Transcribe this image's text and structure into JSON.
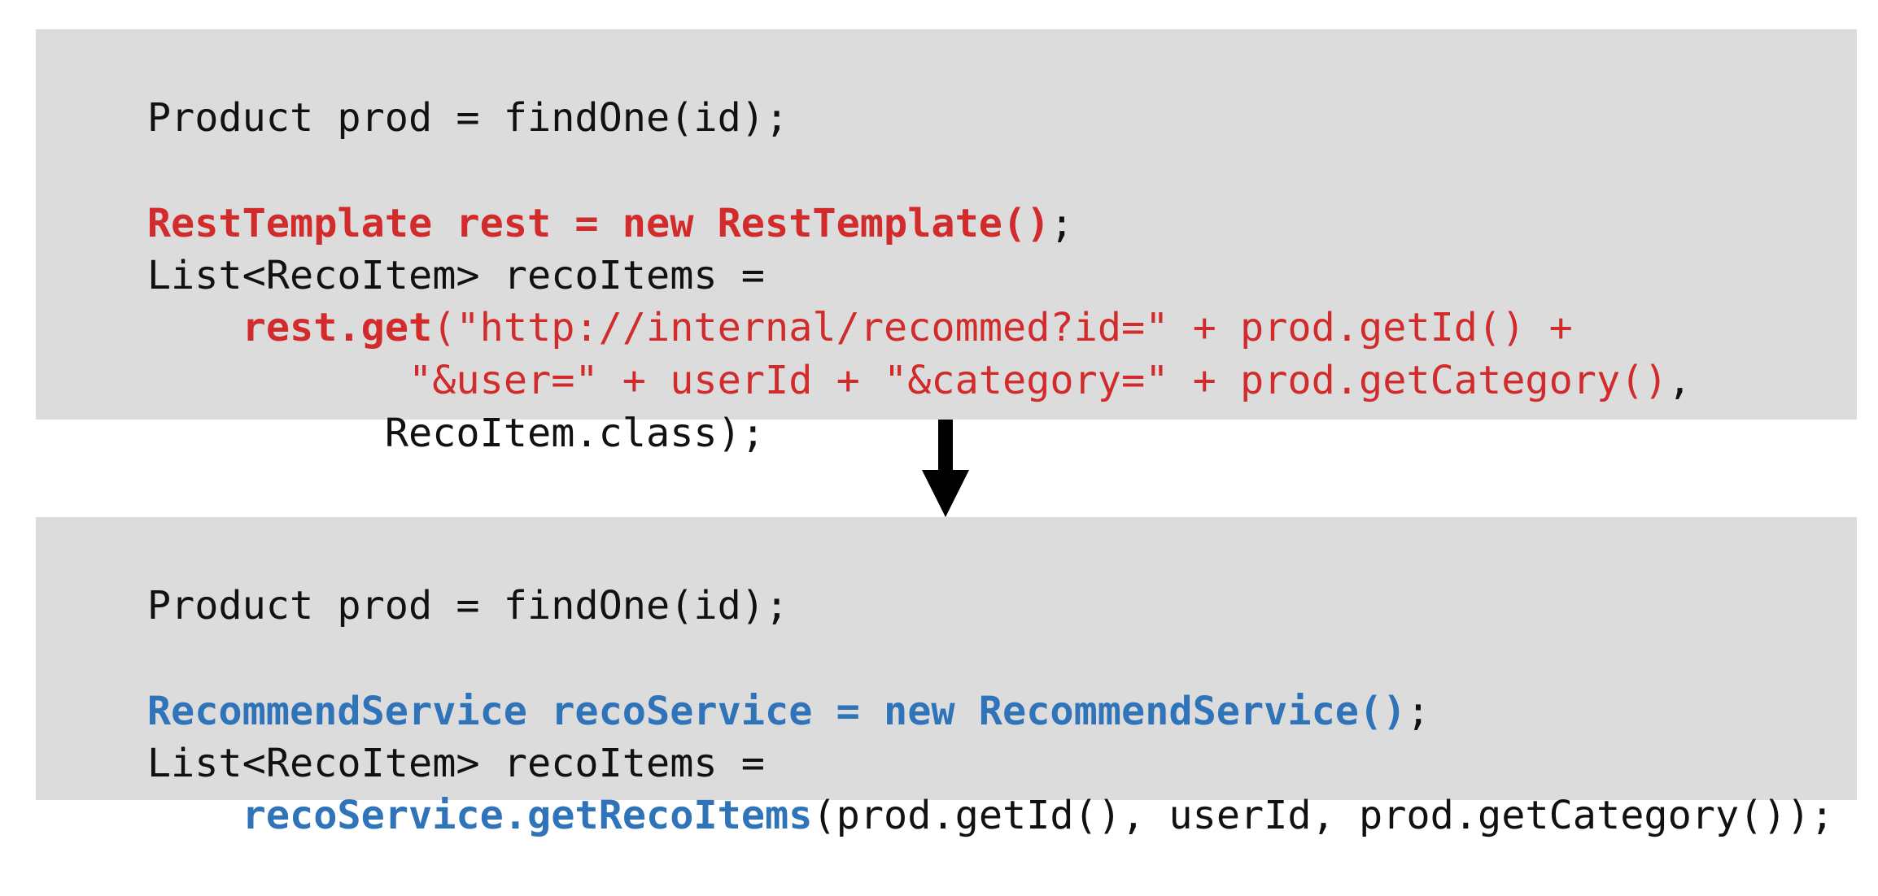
{
  "top_panel": {
    "line1": "Product prod = findOne(id);",
    "line2": {
      "new_rest": "RestTemplate rest = new RestTemplate()",
      "semicolon": ";"
    },
    "line3": "List<RecoItem> recoItems =",
    "line4": {
      "indent": "    ",
      "call": "rest.get",
      "url_part": "(\"http://internal/recommed?id=\" + prod.getId() +"
    },
    "line5": {
      "indent": "           ",
      "params": "\"&user=\" + userId + \"&category=\" + prod.getCategory()",
      "comma": ","
    },
    "line6": {
      "indent": "          ",
      "text": "RecoItem.class);"
    }
  },
  "bottom_panel": {
    "line1": "Product prod = findOne(id);",
    "line2": {
      "new_service": "RecommendService recoService = new RecommendService()",
      "semicolon": ";"
    },
    "line3": "List<RecoItem> recoItems =",
    "line4": {
      "indent": "    ",
      "call": "recoService.getRecoItems",
      "args": "(prod.getId(), userId, prod.getCategory());"
    }
  },
  "colors": {
    "removed_code": "#d12b2b",
    "added_code": "#2f73b8",
    "panel_background": "#dcdcdc",
    "arrow": "#000000"
  },
  "icons": {
    "transition": "arrow-down-icon"
  }
}
